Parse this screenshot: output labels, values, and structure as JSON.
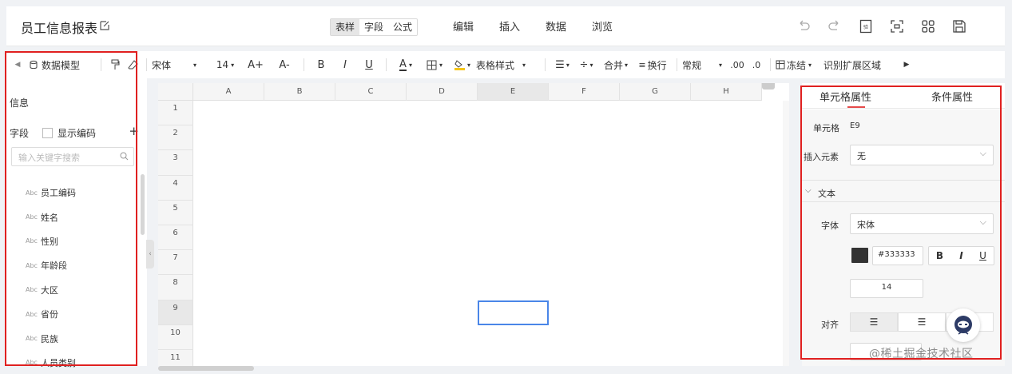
{
  "header": {
    "title": "员工信息报表",
    "mode_tabs": [
      {
        "label": "表样",
        "active": true
      },
      {
        "label": "字段",
        "active": false
      },
      {
        "label": "公式",
        "active": false
      }
    ],
    "menu": [
      "编辑",
      "插入",
      "数据",
      "浏览"
    ],
    "right_icons": [
      "undo-icon",
      "redo-icon",
      "preview-icon",
      "scan-icon",
      "grid-icon",
      "save-icon"
    ]
  },
  "toolbar": {
    "data_model": "数据模型",
    "font": "宋体",
    "font_size": "14",
    "increase_font": "A+",
    "decrease_font": "A-",
    "bold": "B",
    "italic": "I",
    "underline": "U",
    "font_color_glyph": "A",
    "table_style": "表格样式",
    "merge": "合并",
    "wrap": "换行",
    "number_format": "常规",
    "decimal_increase": ".00",
    "decimal_decrease": ".0",
    "freeze": "冻结",
    "expand_area": "识别扩展区域"
  },
  "left_panel": {
    "info_label": "信息",
    "field_label": "字段",
    "show_code_label": "显示编码",
    "search_placeholder": "输入关键字搜索",
    "type_tag": "Abc",
    "fields": [
      "员工编码",
      "姓名",
      "性别",
      "年龄段",
      "大区",
      "省份",
      "民族",
      "人员类别"
    ]
  },
  "grid": {
    "columns": [
      "A",
      "B",
      "C",
      "D",
      "E",
      "F",
      "G",
      "H"
    ],
    "rows": [
      "1",
      "2",
      "3",
      "4",
      "5",
      "6",
      "7",
      "8",
      "9",
      "10",
      "11"
    ],
    "selected_cell": "E9"
  },
  "right_panel": {
    "tabs": [
      {
        "label": "单元格属性",
        "active": true
      },
      {
        "label": "条件属性",
        "active": false
      }
    ],
    "cell_label": "单元格",
    "cell_value": "E9",
    "insert_label": "插入元素",
    "insert_value": "无",
    "text_section": "文本",
    "font_label": "字体",
    "font_value": "宋体",
    "color_hex": "#333333",
    "style_buttons": [
      "B",
      "I",
      "U"
    ],
    "font_size_value": "14",
    "align_label": "对齐"
  },
  "watermark": "@稀土掘金技术社区",
  "colors": {
    "highlight_box": "#e02020",
    "selection": "#4a86e8",
    "tab_underline": "#e54a4a",
    "text_color_swatch": "#333333"
  }
}
